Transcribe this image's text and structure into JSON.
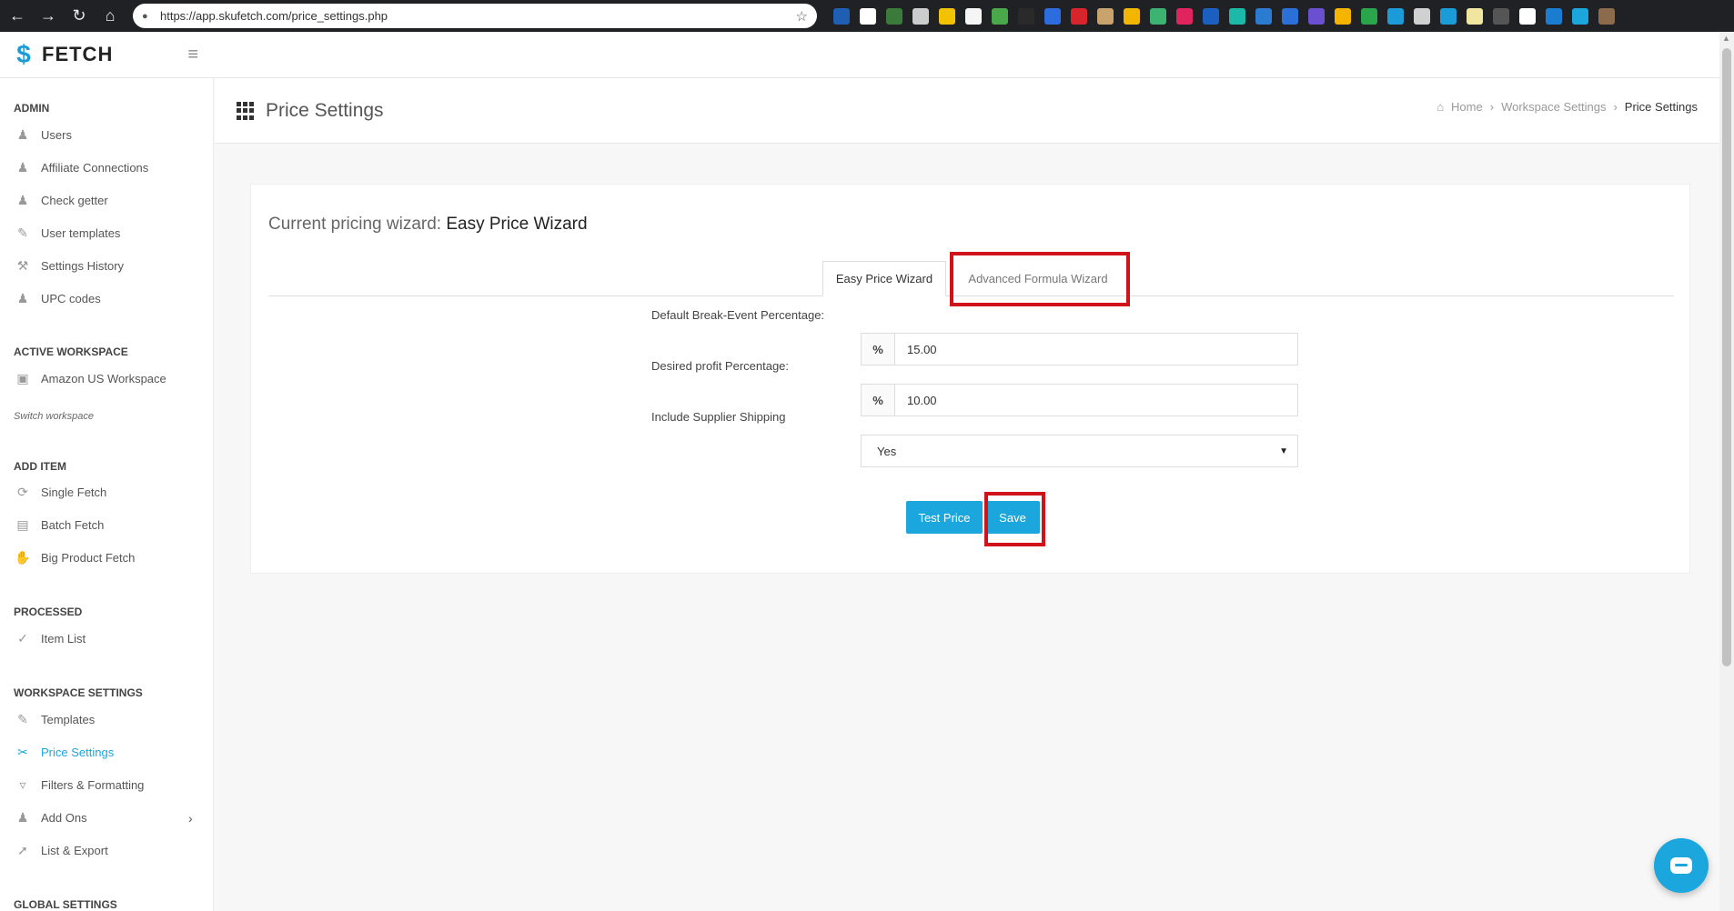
{
  "browser": {
    "url": "https://app.skufetch.com/price_settings.php",
    "back_icon": "←",
    "forward_icon": "→",
    "reload_icon": "↻",
    "home_icon": "⌂",
    "lock_icon": "🔒",
    "star_icon": "☆",
    "extensions": [
      "#1f5fb3",
      "#ffffff",
      "#3a7a3a",
      "#cccccc",
      "#f2c200",
      "#f5f5f5",
      "#4aa84a",
      "#2a2a2a",
      "#2d6cdf",
      "#d8242b",
      "#c8a36b",
      "#f2b600",
      "#3cb371",
      "#e0245e",
      "#1b5fc1",
      "#1db9a8",
      "#2b7bd1",
      "#2b6fd9",
      "#6b4fd1",
      "#f4b400",
      "#2aa54b",
      "#1b9bd7",
      "#d0d0d0",
      "#1b9bd7",
      "#f0e6a0",
      "#555555",
      "#ffffff",
      "#1b7dd1",
      "#1ba6de",
      "#8b6b4b"
    ]
  },
  "app": {
    "logo_mark": "$",
    "logo_text": "FETCH",
    "menu_icon": "≡"
  },
  "sidebar": {
    "sections": {
      "admin": "ADMIN",
      "active_workspace": "ACTIVE WORKSPACE",
      "add_item": "ADD ITEM",
      "processed": "PROCESSED",
      "workspace_settings": "WORKSPACE SETTINGS",
      "global_settings": "GLOBAL SETTINGS"
    },
    "items": {
      "users": "Users",
      "affiliate_connections": "Affiliate Connections",
      "check_getter": "Check getter",
      "user_templates": "User templates",
      "settings_history": "Settings History",
      "upc_codes": "UPC codes",
      "amazon_workspace": "Amazon US Workspace",
      "switch_workspace": "Switch workspace",
      "single_fetch": "Single Fetch",
      "batch_fetch": "Batch Fetch",
      "big_product_fetch": "Big Product Fetch",
      "item_list": "Item List",
      "templates": "Templates",
      "price_settings": "Price Settings",
      "filters_formatting": "Filters & Formatting",
      "add_ons": "Add Ons",
      "list_export": "List & Export"
    },
    "chevron": "›"
  },
  "page": {
    "title": "Price Settings",
    "breadcrumb": {
      "home_icon": "⌂",
      "home": "Home",
      "sep": "›",
      "workspace_settings": "Workspace Settings",
      "current": "Price Settings"
    }
  },
  "wizard": {
    "label": "Current pricing wizard:",
    "current": "Easy Price Wizard",
    "tabs": {
      "easy": "Easy Price Wizard",
      "advanced": "Advanced Formula Wizard"
    },
    "fields": {
      "break_even_label": "Default Break-Event Percentage:",
      "break_even_addon": "%",
      "break_even_value": "15.00",
      "profit_label": "Desired profit Percentage:",
      "profit_addon": "%",
      "profit_value": "10.00",
      "shipping_label": "Include Supplier Shipping",
      "shipping_value": "Yes",
      "select_arrow": "▼"
    },
    "buttons": {
      "test_price": "Test Price",
      "save": "Save"
    }
  },
  "colors": {
    "accent": "#1ba6de",
    "highlight": "#d0121b"
  }
}
